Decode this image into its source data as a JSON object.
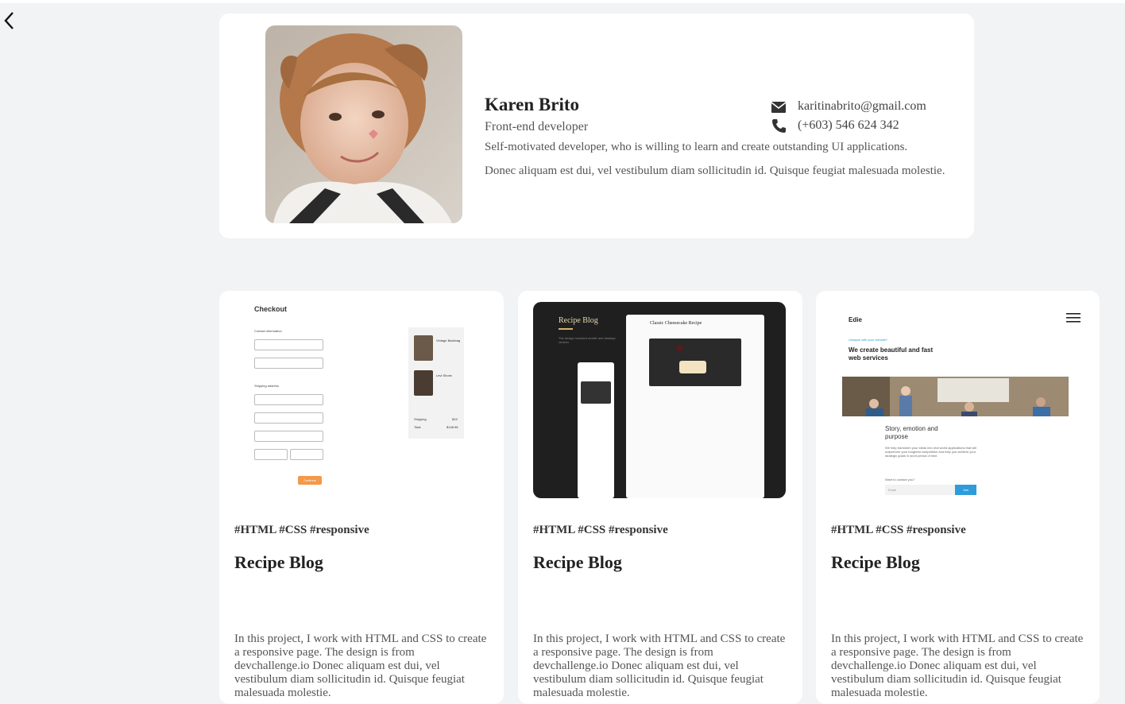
{
  "nav": {
    "back_icon": "chevron-left-icon"
  },
  "profile": {
    "name": "Karen Brito",
    "role": "Front-end developer",
    "bio": "Self-motivated developer, who is willing to learn and create outstanding UI applications.",
    "bio_extra": "Donec aliquam est dui, vel vestibulum diam sollicitudin id. Quisque feugiat malesuada molestie.",
    "email": "karitinabrito@gmail.com",
    "phone": "(+603) 546 624 342",
    "email_icon": "mail-icon",
    "phone_icon": "phone-icon"
  },
  "projects": [
    {
      "tags": "#HTML #CSS #responsive",
      "title": "Recipe Blog",
      "description": "In this project, I work with HTML and CSS to create a responsive page. The design is from devchallenge.io Donec aliquam est dui, vel vestibulum diam sollicitudin id. Quisque feugiat malesuada molestie.",
      "thumb": {
        "heading": "Checkout",
        "contact_label": "Contact information",
        "shipping_label": "Shipping address",
        "button": "Continue",
        "item1": "Vintage Backbag",
        "item2": "Levi Shoes",
        "shipping": "Shipping",
        "total": "Total",
        "shipping_val": "$19",
        "total_val": "$148.98"
      }
    },
    {
      "tags": "#HTML #CSS #responsive",
      "title": "Recipe Blog",
      "description": "In this project, I work with HTML and CSS to create a responsive page. The design is from devchallenge.io Donec aliquam est dui, vel vestibulum diam sollicitudin id. Quisque feugiat malesuada molestie.",
      "thumb": {
        "heading": "Recipe Blog",
        "sub": "The design included mobile and desktop version",
        "card_title": "Classic Cheesecake Recipe"
      }
    },
    {
      "tags": "#HTML #CSS #responsive",
      "title": "Recipe Blog",
      "description": "In this project, I work with HTML and CSS to create a responsive page. The design is from devchallenge.io Donec aliquam est dui, vel vestibulum diam sollicitudin id. Quisque feugiat malesuada molestie.",
      "thumb": {
        "brand": "Edie",
        "kicker": "Untappe with your website?",
        "headline": "We create beautiful and fast web services",
        "sub": "Story, emotion and purpose",
        "body": "We help transform your ideas into real world applications that will outperform your toughest competition and help you achieve your strategic goals in short period of time.",
        "form_label": "Want to contact you?",
        "input_placeholder": "Email",
        "button": "Join",
        "menu_icon": "hamburger-menu-icon"
      }
    }
  ]
}
